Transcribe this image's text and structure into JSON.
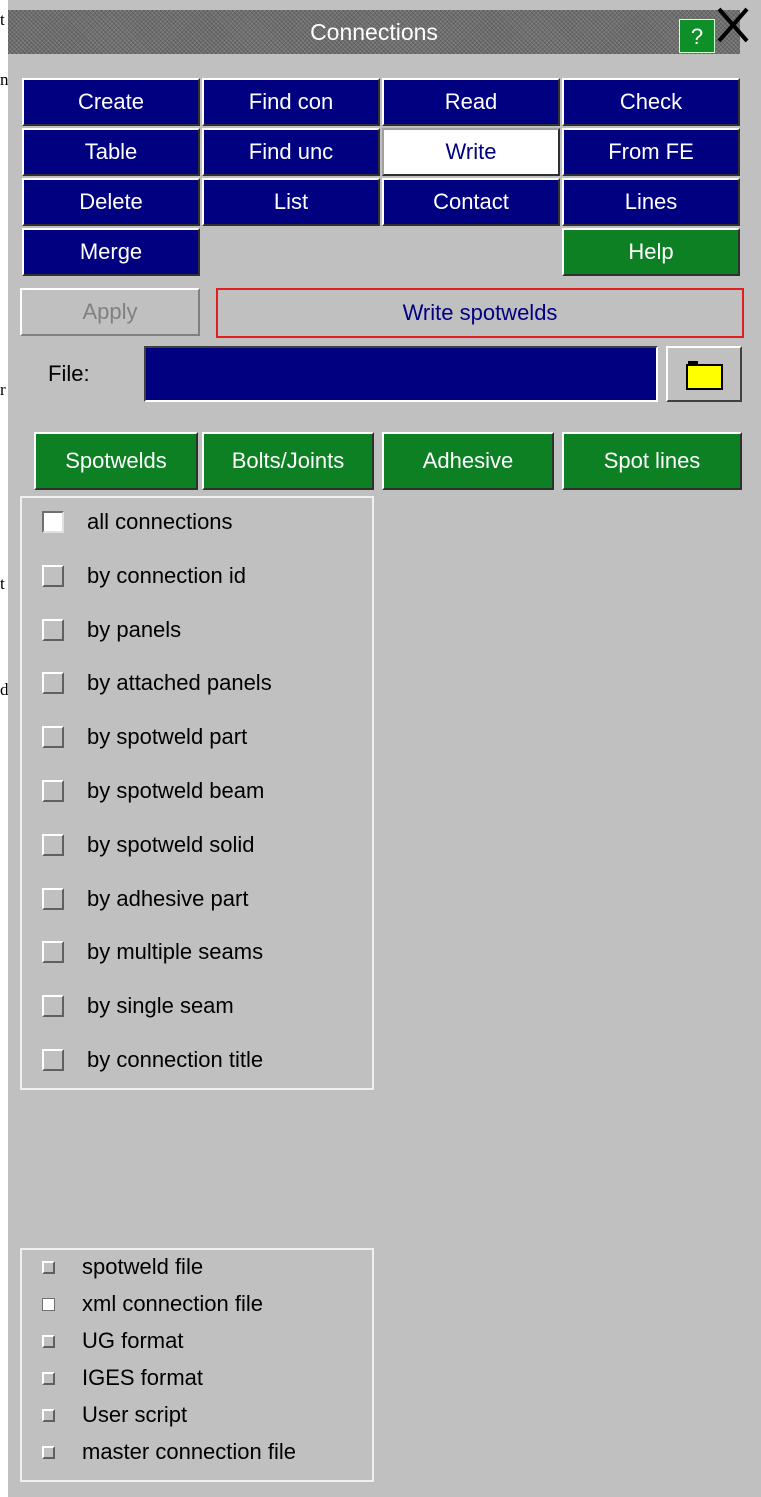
{
  "edge_chars": [
    "t",
    "n",
    "r",
    "t",
    "d"
  ],
  "window": {
    "title": "Connections",
    "help_label": "?",
    "close_label": "✕"
  },
  "menu": [
    {
      "label": "Create",
      "style": "blue"
    },
    {
      "label": "Find con",
      "style": "blue"
    },
    {
      "label": "Read",
      "style": "blue"
    },
    {
      "label": "Check",
      "style": "blue"
    },
    {
      "label": "Table",
      "style": "blue"
    },
    {
      "label": "Find unc",
      "style": "blue"
    },
    {
      "label": "Write",
      "style": "white"
    },
    {
      "label": "From FE",
      "style": "blue"
    },
    {
      "label": "Delete",
      "style": "blue"
    },
    {
      "label": "List",
      "style": "blue"
    },
    {
      "label": "Contact",
      "style": "blue"
    },
    {
      "label": "Lines",
      "style": "blue"
    },
    {
      "label": "Merge",
      "style": "blue"
    },
    {
      "label": "Help",
      "style": "green"
    }
  ],
  "apply_label": "Apply",
  "status_text": "Write spotwelds",
  "file": {
    "label": "File:",
    "value": "",
    "folder_icon_color": "#ffff00"
  },
  "type_tabs": [
    "Spotwelds",
    "Bolts/Joints",
    "Adhesive",
    "Spot lines"
  ],
  "selection_options": [
    {
      "label": "all connections",
      "checked": true
    },
    {
      "label": "by connection id",
      "checked": false
    },
    {
      "label": "by panels",
      "checked": false
    },
    {
      "label": "by attached panels",
      "checked": false
    },
    {
      "label": "by spotweld part",
      "checked": false
    },
    {
      "label": "by spotweld beam",
      "checked": false
    },
    {
      "label": "by spotweld solid",
      "checked": false
    },
    {
      "label": "by adhesive part",
      "checked": false
    },
    {
      "label": "by multiple seams",
      "checked": false
    },
    {
      "label": "by single seam",
      "checked": false
    },
    {
      "label": "by connection title",
      "checked": false
    }
  ],
  "format_options": [
    {
      "label": "spotweld file",
      "checked": false
    },
    {
      "label": "xml connection file",
      "checked": true
    },
    {
      "label": "UG format",
      "checked": false
    },
    {
      "label": "IGES format",
      "checked": false
    },
    {
      "label": "User script",
      "checked": false
    },
    {
      "label": "master connection file",
      "checked": false
    }
  ],
  "colors": {
    "panel_bg": "#c0c0c0",
    "button_blue": "#000080",
    "button_green": "#0e8024",
    "status_border": "#e02020"
  }
}
